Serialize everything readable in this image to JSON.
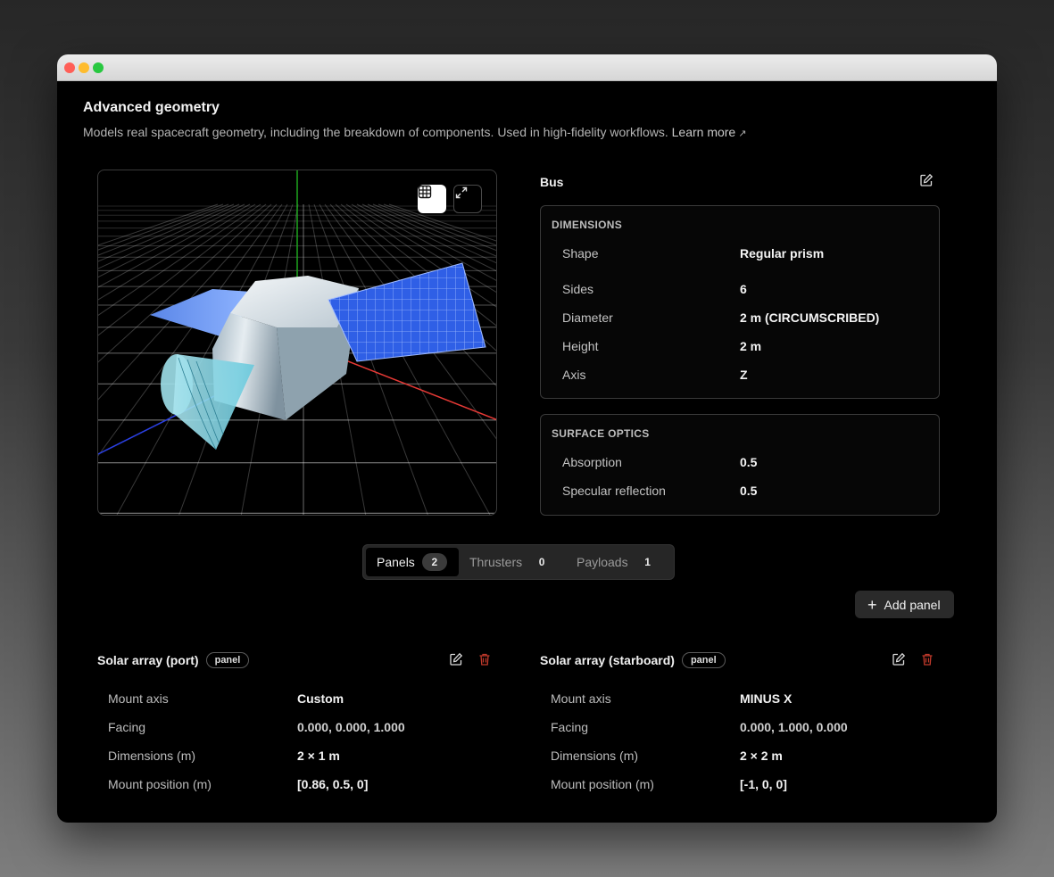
{
  "section": {
    "title": "Advanced geometry",
    "description": "Models real spacecraft geometry, including the breakdown of components. Used in high-fidelity workflows.",
    "learn_more": "Learn more",
    "learn_more_icon": "external-link-icon"
  },
  "viewport": {
    "grid_toggle_icon": "grid-icon",
    "expand_icon": "expand-icon",
    "colors": {
      "x_axis": "#e53935",
      "y_axis": "#1ea51e",
      "z_axis": "#2a3fe0",
      "solar_panel": "#2f5fe6",
      "bus": "#b9c6cf",
      "sensor_cone": "#7fd6e6"
    }
  },
  "bus": {
    "title": "Bus",
    "edit_icon": "edit-icon",
    "dimensions": {
      "title": "DIMENSIONS",
      "rows": [
        {
          "label": "Shape",
          "value": "Regular prism"
        },
        {
          "label": "Sides",
          "value": "6"
        },
        {
          "label": "Diameter",
          "value": "2 m (CIRCUMSCRIBED)"
        },
        {
          "label": "Height",
          "value": "2 m"
        },
        {
          "label": "Axis",
          "value": "Z"
        }
      ]
    },
    "optics": {
      "title": "SURFACE OPTICS",
      "rows": [
        {
          "label": "Absorption",
          "value": "0.5"
        },
        {
          "label": "Specular reflection",
          "value": "0.5"
        }
      ]
    }
  },
  "tabs": [
    {
      "label": "Panels",
      "count": "2",
      "active": true
    },
    {
      "label": "Thrusters",
      "count": "0",
      "active": false
    },
    {
      "label": "Payloads",
      "count": "1",
      "active": false
    }
  ],
  "add_button": {
    "label": "Add panel",
    "icon": "plus-icon"
  },
  "panels": [
    {
      "name": "Solar array (port)",
      "tag": "panel",
      "rows": [
        {
          "label": "Mount axis",
          "value": "Custom"
        },
        {
          "label": "Facing",
          "value": "0.000, 0.000, 1.000"
        },
        {
          "label": "Dimensions (m)",
          "value": "2 × 1 m"
        },
        {
          "label": "Mount position (m)",
          "value": "[0.86, 0.5, 0]"
        }
      ]
    },
    {
      "name": "Solar array (starboard)",
      "tag": "panel",
      "rows": [
        {
          "label": "Mount axis",
          "value": "MINUS X"
        },
        {
          "label": "Facing",
          "value": "0.000, 1.000, 0.000"
        },
        {
          "label": "Dimensions (m)",
          "value": "2 × 2 m"
        },
        {
          "label": "Mount position (m)",
          "value": "[-1, 0, 0]"
        }
      ]
    }
  ],
  "colors": {
    "delete": "#c0392b",
    "accent_badge": "#3b3b3b"
  }
}
